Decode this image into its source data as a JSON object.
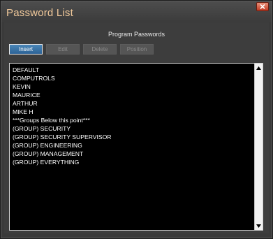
{
  "window": {
    "title": "Password List"
  },
  "panel": {
    "heading": "Program Passwords"
  },
  "toolbar": {
    "insert_label": "Insert",
    "edit_label": "Edit",
    "delete_label": "Delete",
    "position_label": "Position"
  },
  "list": {
    "items": [
      "DEFAULT",
      "COMPUTROLS",
      "KEVIN",
      "MAURICE",
      "ARTHUR",
      "MIKE H",
      "***Groups Below this point***",
      "(GROUP) SECURITY",
      "(GROUP) SECURITY SUPERVISOR",
      "(GROUP) ENGINEERING",
      "(GROUP) MANAGEMENT",
      "(GROUP) EVERYTHING"
    ]
  },
  "colors": {
    "title_text": "#f0c89a",
    "accent_button": "#2d6396",
    "list_background": "#000000",
    "close_button": "#c23a22"
  },
  "icons": {
    "close": "close-icon",
    "scroll_up": "arrow-up-icon",
    "scroll_down": "arrow-down-icon"
  }
}
